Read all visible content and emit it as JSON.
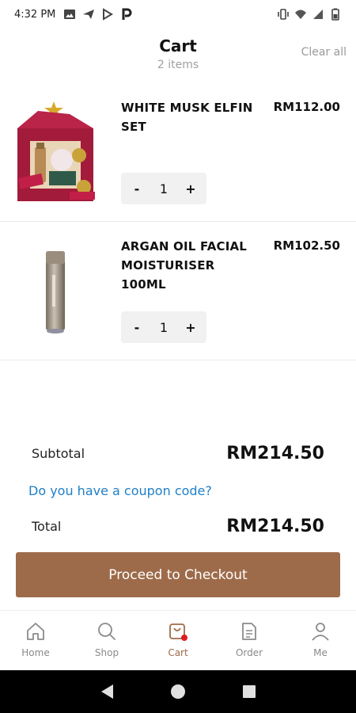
{
  "status_bar": {
    "time": "4:32 PM",
    "left_icons": [
      "image-icon",
      "send-icon",
      "play-store-icon",
      "p-app-icon"
    ],
    "right_icons": [
      "vibrate-icon",
      "wifi-icon",
      "signal-icon",
      "battery-icon"
    ]
  },
  "header": {
    "title": "Cart",
    "subtitle": "2 items",
    "clear_all": "Clear all"
  },
  "items": [
    {
      "name": "WHITE MUSK ELFIN SET",
      "price": "RM112.00",
      "quantity": "1",
      "image": "gift-set-image"
    },
    {
      "name": "ARGAN OIL FACIAL MOISTURISER 100ML",
      "price": "RM102.50",
      "quantity": "1",
      "image": "moisturiser-bottle-image"
    }
  ],
  "qty_controls": {
    "minus": "-",
    "plus": "+"
  },
  "summary": {
    "subtotal_label": "Subtotal",
    "subtotal_value": "RM214.50",
    "coupon_link": "Do you have a coupon code?",
    "total_label": "Total",
    "total_value": "RM214.50"
  },
  "checkout_button": "Proceed to Checkout",
  "bottom_nav": [
    {
      "label": "Home",
      "icon": "home-icon",
      "active": false
    },
    {
      "label": "Shop",
      "icon": "search-icon",
      "active": false
    },
    {
      "label": "Cart",
      "icon": "cart-icon",
      "active": true
    },
    {
      "label": "Order",
      "icon": "order-icon",
      "active": false
    },
    {
      "label": "Me",
      "icon": "user-icon",
      "active": false
    }
  ],
  "colors": {
    "accent": "#9e6b4a",
    "link": "#1f7fc7",
    "badge": "#e01b24",
    "muted": "#a0a0a0"
  }
}
